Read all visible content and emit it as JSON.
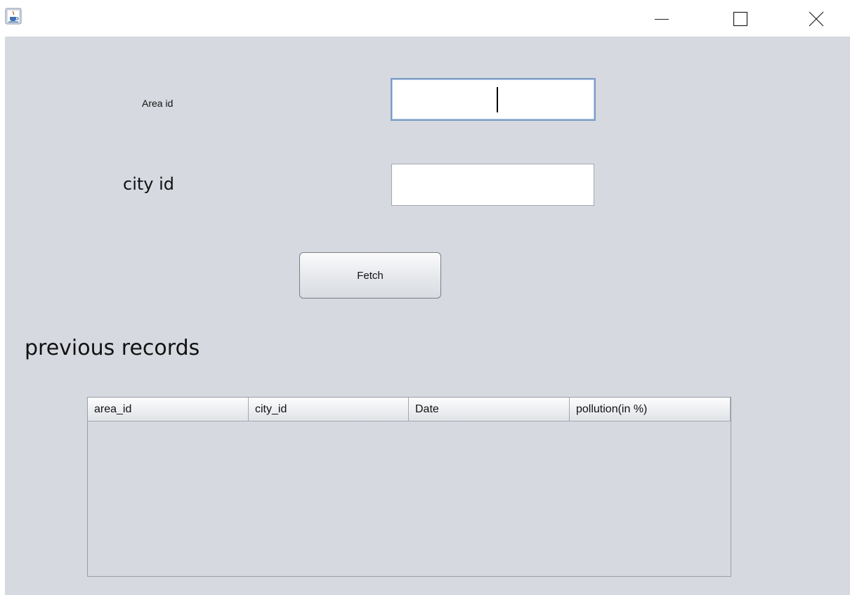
{
  "window": {
    "title": "",
    "controls": {
      "minimize_icon": "minimize-icon",
      "maximize_icon": "maximize-icon",
      "close_icon": "close-icon"
    }
  },
  "form": {
    "area_label": "Area id",
    "area_value": "",
    "city_label": "city id",
    "city_value": "",
    "fetch_label": "Fetch"
  },
  "records": {
    "title": "previous records",
    "columns": [
      "area_id",
      "city_id",
      "Date",
      "pollution(in %)"
    ],
    "rows": []
  },
  "colors": {
    "background": "#d6d9e0",
    "focus_border": "#7a9cc6"
  }
}
